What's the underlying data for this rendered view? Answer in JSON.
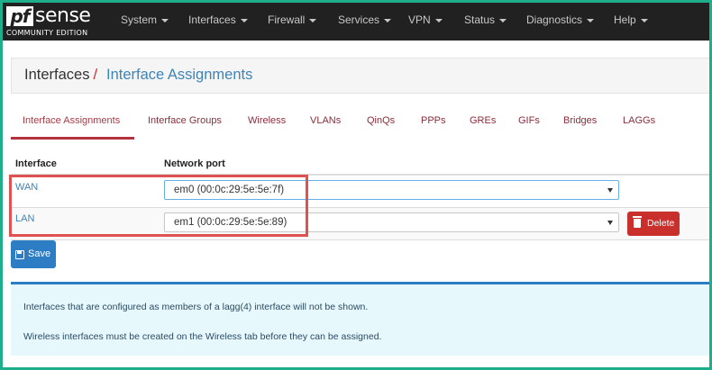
{
  "brand": {
    "logo_pf": "pf",
    "logo_sense": "sense",
    "edition": "COMMUNITY EDITION"
  },
  "nav": {
    "items": [
      {
        "label": "System"
      },
      {
        "label": "Interfaces"
      },
      {
        "label": "Firewall"
      },
      {
        "label": "Services"
      },
      {
        "label": "VPN"
      },
      {
        "label": "Status"
      },
      {
        "label": "Diagnostics"
      },
      {
        "label": "Help"
      }
    ]
  },
  "breadcrumb": {
    "parent": "Interfaces",
    "separator": "/",
    "current": "Interface Assignments"
  },
  "tabs": [
    {
      "label": "Interface Assignments",
      "active": true
    },
    {
      "label": "Interface Groups"
    },
    {
      "label": "Wireless"
    },
    {
      "label": "VLANs"
    },
    {
      "label": "QinQs"
    },
    {
      "label": "PPPs"
    },
    {
      "label": "GREs"
    },
    {
      "label": "GIFs"
    },
    {
      "label": "Bridges"
    },
    {
      "label": "LAGGs"
    }
  ],
  "table": {
    "headers": {
      "interface": "Interface",
      "port": "Network port"
    },
    "rows": [
      {
        "interface": "WAN",
        "port": "em0 (00:0c:29:5e:5e:7f)"
      },
      {
        "interface": "LAN",
        "port": "em1 (00:0c:29:5e:5e:89)",
        "action": "Delete"
      }
    ]
  },
  "actions": {
    "save": "Save"
  },
  "info": {
    "line1": "Interfaces that are configured as members of a lagg(4) interface will not be shown.",
    "line2": "Wireless interfaces must be created on the Wireless tab before they can be assigned."
  },
  "colors": {
    "navbar": "#212121",
    "link": "#3f84b7",
    "tab_text": "#8b2c3a",
    "danger": "#c9302c",
    "primary": "#2d7dc4",
    "info_bg": "#e7f8fd",
    "highlight": "#e05252",
    "frame": "#1fae8c"
  }
}
